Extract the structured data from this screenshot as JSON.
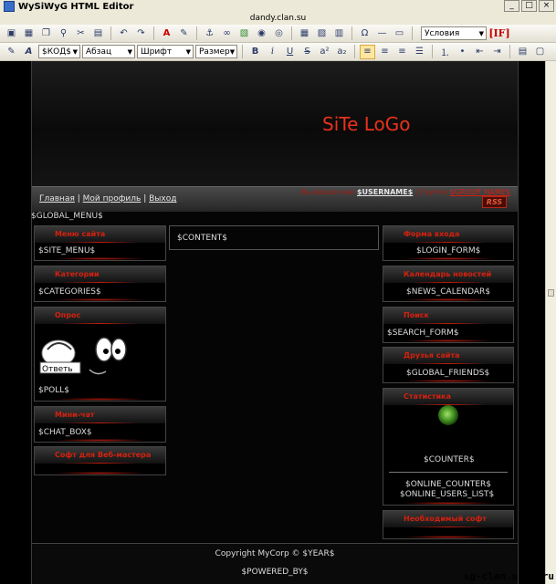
{
  "window": {
    "title": "WySiWyG HTML Editor",
    "document": "dandy.clan.su",
    "buttons": [
      "_",
      "□",
      "×"
    ]
  },
  "toolbar1": {
    "icons": [
      "save-icon",
      "save-as-icon",
      "copy-icon",
      "find-icon",
      "cut-icon",
      "paste-icon",
      "undo-icon",
      "redo-icon",
      "font-color-icon",
      "highlight-icon",
      "anchor-icon",
      "link-icon",
      "image-icon",
      "flash-icon",
      "media-icon",
      "table-icon",
      "form-icon",
      "insert-icon",
      "special-char-icon",
      "hr-icon",
      "textarea-icon"
    ],
    "special_char": "Ω",
    "conditions": "Условия",
    "if_label": "[IF]"
  },
  "toolbar2": {
    "code_select": "$КОД$",
    "paragraph_select": "Абзац",
    "font_select": "Шрифт",
    "size_select": "Размер",
    "format_buttons": [
      "B",
      "i",
      "U",
      "S",
      "a²",
      "a₂"
    ],
    "align_buttons": [
      "align-left-icon",
      "align-center-icon",
      "align-right-icon",
      "align-justify-icon"
    ],
    "list_buttons": [
      "ordered-list-icon",
      "bullet-list-icon",
      "outdent-icon",
      "indent-icon"
    ]
  },
  "site": {
    "logo": "SiTe LoGo",
    "welcome_prefix": "Вы вошли как",
    "username": "$USERNAME$",
    "group_prefix": "| Группа",
    "group_name": "$GROUP_NAME$",
    "nav": [
      "Главная",
      "Мой профиль",
      "Выход"
    ],
    "rss": "RSS",
    "global_menu": "$GLOBAL_MENU$",
    "content": "$CONTENT$",
    "left_blocks": [
      {
        "title": "Меню сайта",
        "value": "$SITE_MENU$"
      },
      {
        "title": "Категории",
        "value": "$CATEGORIES$"
      },
      {
        "title": "Опрос",
        "value": "$POLL$",
        "poll_caption": "Ответь"
      },
      {
        "title": "Мини-чат",
        "value": "$CHAT_BOX$"
      },
      {
        "title": "Софт для Веб-мастера",
        "value": ""
      }
    ],
    "right_blocks": [
      {
        "title": "Форма входа",
        "value": "$LOGIN_FORM$"
      },
      {
        "title": "Календарь новостей",
        "value": "$NEWS_CALENDAR$"
      },
      {
        "title": "Поиск",
        "value": "$SEARCH_FORM$"
      },
      {
        "title": "Друзья сайта",
        "value": "$GLOBAL_FRIENDS$"
      },
      {
        "title": "Статистика",
        "value": "$COUNTER$",
        "extra1": "$ONLINE_COUNTER$",
        "extra2": "$ONLINE_USERS_LIST$"
      },
      {
        "title": "Необходимый софт",
        "value": ""
      }
    ],
    "copyright": "Copyright MyCorp © $YEAR$",
    "powered": "$POWERED_BY$"
  },
  "watermark": "sg-clan.ucoz.ru",
  "colors": {
    "accent_red": "#d3210f",
    "logo_red": "#e8321a",
    "background": "#050505",
    "text": "#dcdcdc"
  }
}
